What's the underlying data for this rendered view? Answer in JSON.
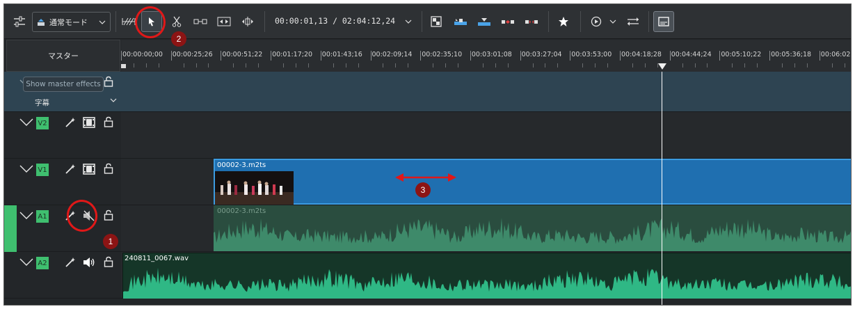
{
  "toolbar": {
    "mode_label": "通常モード",
    "timecode": "00:00:01,13 / 02:04:12,24"
  },
  "master": {
    "label": "マスター",
    "tooltip": "Show master effects",
    "subtitle_select": "字幕"
  },
  "ruler": {
    "labels": [
      "00:00:00;00",
      "00:00:25;26",
      "00:00:51;22",
      "00:01:17;20",
      "00:01:43;16",
      "00:02:09;14",
      "00:02:35;10",
      "00:03:01;08",
      "00:03:27;04",
      "00:03:53;00",
      "00:04:18;28",
      "00:04:44;24",
      "00:05:10;22",
      "00:05:36;18",
      "00:06:02"
    ]
  },
  "tracks": {
    "v2": "V2",
    "v1": "V1",
    "a1": "A1",
    "a2": "A2"
  },
  "clips": {
    "video": "00002-3.m2ts",
    "audio_a1": "00002-3.m2ts",
    "audio_a2": "240811_0067.wav"
  },
  "annotations": {
    "one": "1",
    "two": "2",
    "three": "3"
  },
  "colors": {
    "accent": "#3fbf6f",
    "clip_video": "#1f6fb0",
    "annotation": "#e01818"
  },
  "icons": [
    "settings-sliders-icon",
    "edit-mode-icon",
    "spacer-tool-icon",
    "pointer-icon",
    "razor-icon",
    "ripple-icon",
    "slip-icon",
    "multicam-icon",
    "overwrite-icon",
    "insert-icon",
    "lift-icon",
    "extract-icon",
    "star-icon",
    "play-icon",
    "mixer-icon",
    "subtitle-icon",
    "effects-wand-icon",
    "film-icon",
    "lock-icon",
    "mute-icon",
    "speaker-icon"
  ]
}
